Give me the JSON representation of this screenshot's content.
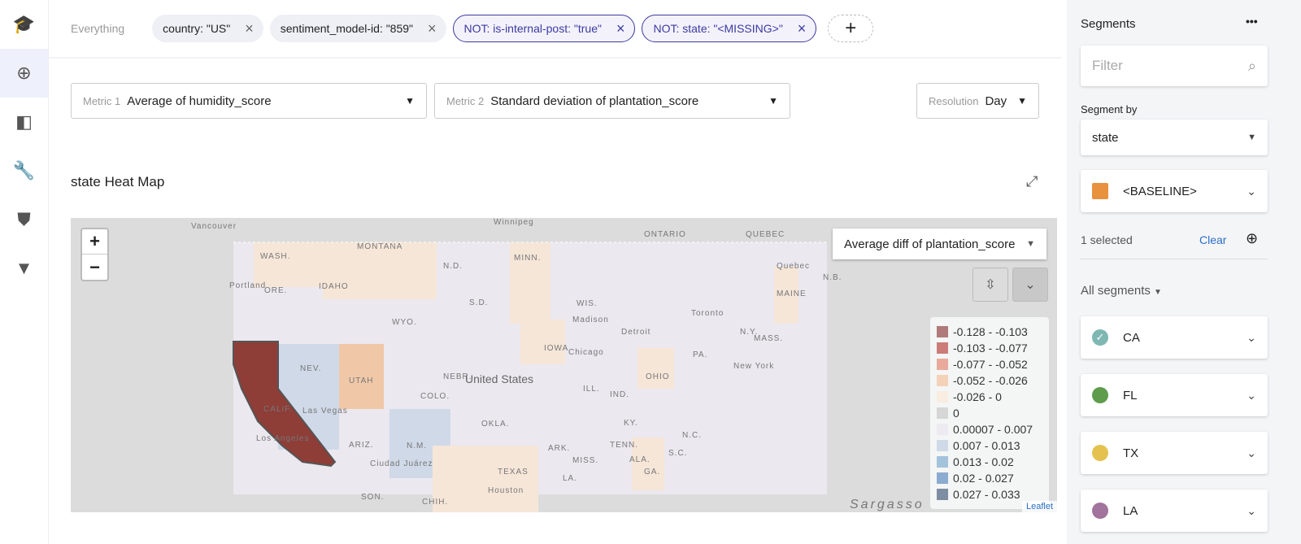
{
  "nav": {
    "items": [
      {
        "icon": "graduation-cap-icon",
        "glyph": "🎓"
      },
      {
        "icon": "zoom-in-icon",
        "glyph": "⊕"
      },
      {
        "icon": "compare-icon",
        "glyph": "◧"
      },
      {
        "icon": "wrench-icon",
        "glyph": "🔧"
      },
      {
        "icon": "shield-icon",
        "glyph": "⛊"
      },
      {
        "icon": "wifi-warning-icon",
        "glyph": "▼"
      }
    ]
  },
  "filters": {
    "scope": "Everything",
    "chips": [
      {
        "label": "country: \"US\"",
        "negated": false
      },
      {
        "label": "sentiment_model-id: \"859\"",
        "negated": false
      },
      {
        "label": "NOT: is-internal-post: \"true\"",
        "negated": true
      },
      {
        "label": "NOT: state: \"<MISSING>\"",
        "negated": true
      }
    ],
    "add": "+",
    "remove": "×"
  },
  "metric1": {
    "label": "Metric 1",
    "value": "Average of humidity_score"
  },
  "metric2": {
    "label": "Metric 2",
    "value": "Standard deviation of plantation_score"
  },
  "resolution": {
    "label": "Resolution",
    "value": "Day"
  },
  "heatmap": {
    "title": "state Heat Map",
    "metric": "Average diff of plantation_score",
    "zoom_in": "+",
    "zoom_out": "−",
    "attribution": "Leaflet",
    "legend": [
      {
        "label": "-0.128 - -0.103",
        "color": "#b07a7a"
      },
      {
        "label": "-0.103 - -0.077",
        "color": "#cc7c78"
      },
      {
        "label": "-0.077 - -0.052",
        "color": "#e9aa9c"
      },
      {
        "label": "-0.052 - -0.026",
        "color": "#f4d2b8"
      },
      {
        "label": "-0.026 - 0",
        "color": "#f9ece0"
      },
      {
        "label": "0",
        "color": "#d6d6d6"
      },
      {
        "label": "0.00007 - 0.007",
        "color": "#eeeaf2"
      },
      {
        "label": "0.007 - 0.013",
        "color": "#cfd9e8"
      },
      {
        "label": "0.013 - 0.02",
        "color": "#a3c3db"
      },
      {
        "label": "0.02 - 0.027",
        "color": "#8cabd0"
      },
      {
        "label": "0.027 - 0.033",
        "color": "#7d8ea3"
      }
    ],
    "labels": [
      "Vancouver",
      "Winnipeg",
      "ONTARIO",
      "QUEBEC",
      "WASH.",
      "MONTANA",
      "N.D.",
      "MINN.",
      "Quebec",
      "N.B.",
      "Portland",
      "S.D.",
      "WIS.",
      "MAINE",
      "ORE.",
      "IDAHO",
      "WYO.",
      "Madison",
      "Detroit",
      "Toronto",
      "N.Y.",
      "IOWA",
      "Chicago",
      "MASS.",
      "NEV.",
      "UTAH",
      "NEBR.",
      "United States",
      "OHIO",
      "PA.",
      "New York",
      "CALIF.",
      "COLO.",
      "ILL.",
      "IND.",
      "KY.",
      "Las Vegas",
      "TENN.",
      "N.C.",
      "Los Angeles",
      "ARIZ.",
      "N.M.",
      "OKLA.",
      "ARK.",
      "S.C.",
      "Ciudad Juárez",
      "MISS.",
      "ALA.",
      "GA.",
      "TEXAS",
      "LA.",
      "SON.",
      "CHIH.",
      "Houston",
      "Sargasso"
    ]
  },
  "sidebar": {
    "title": "Segments",
    "more": "•••",
    "filter_placeholder": "Filter",
    "segment_by_label": "Segment by",
    "segment_by": "state",
    "baseline": {
      "label": "<BASELINE>",
      "color": "#e8913f"
    },
    "selected_count": "1 selected",
    "clear": "Clear",
    "all_segments": "All segments",
    "segments": [
      {
        "label": "CA",
        "color": "#7fb7b3",
        "checked": true
      },
      {
        "label": "FL",
        "color": "#5e9c4c"
      },
      {
        "label": "TX",
        "color": "#e5c24f"
      },
      {
        "label": "LA",
        "color": "#a2739c"
      }
    ]
  }
}
